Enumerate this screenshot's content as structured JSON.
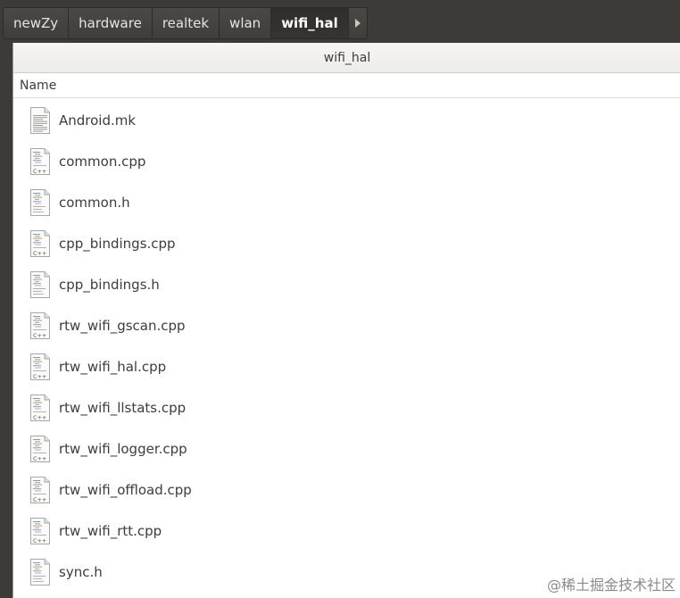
{
  "path_bar": {
    "crumbs": [
      "newZy",
      "hardware",
      "realtek",
      "wlan",
      "wifi_hal"
    ],
    "scroll_icon": "triangle-right-icon"
  },
  "window": {
    "title": "wifi_hal"
  },
  "list": {
    "column_name": "Name",
    "files": [
      {
        "name": "Android.mk",
        "icon": "text-file-icon"
      },
      {
        "name": "common.cpp",
        "icon": "cpp-file-icon"
      },
      {
        "name": "common.h",
        "icon": "header-file-icon"
      },
      {
        "name": "cpp_bindings.cpp",
        "icon": "cpp-file-icon"
      },
      {
        "name": "cpp_bindings.h",
        "icon": "header-file-icon"
      },
      {
        "name": "rtw_wifi_gscan.cpp",
        "icon": "cpp-file-icon"
      },
      {
        "name": "rtw_wifi_hal.cpp",
        "icon": "cpp-file-icon"
      },
      {
        "name": "rtw_wifi_llstats.cpp",
        "icon": "cpp-file-icon"
      },
      {
        "name": "rtw_wifi_logger.cpp",
        "icon": "cpp-file-icon"
      },
      {
        "name": "rtw_wifi_offload.cpp",
        "icon": "cpp-file-icon"
      },
      {
        "name": "rtw_wifi_rtt.cpp",
        "icon": "cpp-file-icon"
      },
      {
        "name": "sync.h",
        "icon": "header-file-icon"
      }
    ],
    "cpp_badge": "C++"
  },
  "watermark": "@稀土掘金技术社区"
}
